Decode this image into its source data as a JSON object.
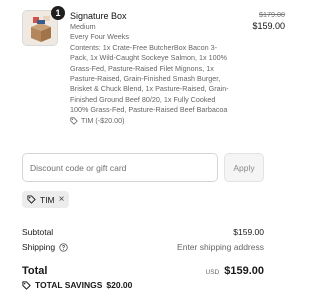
{
  "line_item": {
    "quantity": "1",
    "name": "Signature Box",
    "variant": "Medium",
    "frequency": "Every Four Weeks",
    "contents": "Contents: 1x Crate-Free ButcherBox Bacon 3-Pack, 1x Wild-Caught Sockeye Salmon, 1x 100% Grass-Fed, Pasture-Raised Filet Mignons, 1x Pasture-Raised, Grain-Finished Smash Burger, Brisket & Chuck Blend, 1x Pasture-Raised, Grain-Finished Ground Beef 80/20, 1x Fully Cooked 100% Grass-Fed, Pasture-Raised Beef Barbacoa",
    "discount_line": "TIM (-$20.00)",
    "compare_price": "$179.00",
    "price": "$159.00",
    "icon": "tag-icon"
  },
  "discount": {
    "placeholder": "Discount code or gift card",
    "value": "",
    "apply_label": "Apply"
  },
  "applied_code": {
    "label": "TIM",
    "icon": "tag-icon",
    "remove_icon": "close-icon"
  },
  "summary": {
    "subtotal_label": "Subtotal",
    "subtotal_value": "$159.00",
    "shipping_label": "Shipping",
    "shipping_icon": "help-circle-icon",
    "shipping_value": "Enter shipping address",
    "total_label": "Total",
    "currency": "USD",
    "total_value": "$159.00",
    "savings_label": "TOTAL SAVINGS",
    "savings_value": "$20.00",
    "savings_icon": "tag-icon"
  },
  "colors": {
    "text": "#1a1a1a",
    "muted": "#666666",
    "badge_bg": "#1f1f1f",
    "chip_bg": "#ececec",
    "border": "#d6d6d6"
  }
}
